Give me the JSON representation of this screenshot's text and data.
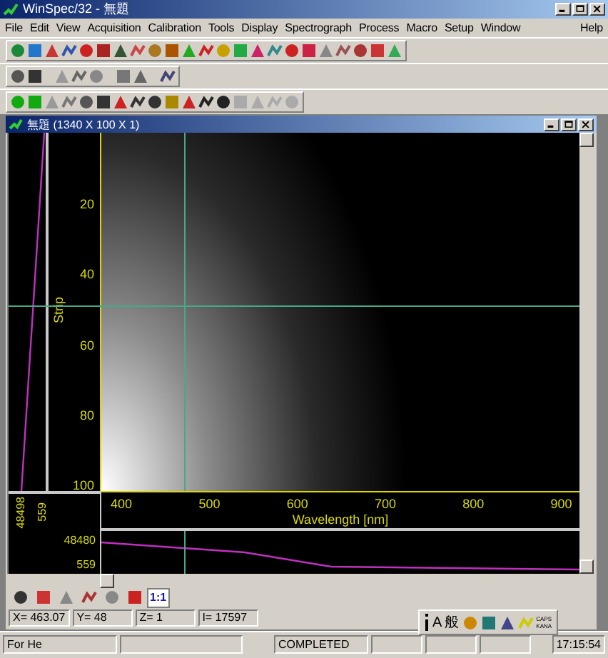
{
  "window": {
    "title": "WinSpec/32 - 無題"
  },
  "menu": [
    "File",
    "Edit",
    "View",
    "Acquisition",
    "Calibration",
    "Tools",
    "Display",
    "Spectrograph",
    "Process",
    "Macro",
    "Setup",
    "Window",
    "Help"
  ],
  "document": {
    "title": "無題 (1340 X 100 X 1)",
    "y_axis": {
      "label": "Strip",
      "ticks": [
        "20",
        "40",
        "60",
        "80",
        "100"
      ]
    },
    "x_axis": {
      "label": "Wavelength [nm]",
      "ticks": [
        "400",
        "500",
        "600",
        "700",
        "800",
        "900"
      ]
    },
    "profile_labels": [
      "48498",
      "559"
    ],
    "graph_labels": [
      "48480",
      "559"
    ],
    "zoom_label": "1:1",
    "readout": [
      "X= 463.07",
      "Y= 48",
      "Z= 1",
      "I= 17597"
    ]
  },
  "ime_bar": {
    "chars": [
      "A",
      "般"
    ],
    "caps": "CAPS",
    "kana": "KANA"
  },
  "status_bar": [
    "For He",
    "COMPLETED",
    "17:15:54"
  ]
}
